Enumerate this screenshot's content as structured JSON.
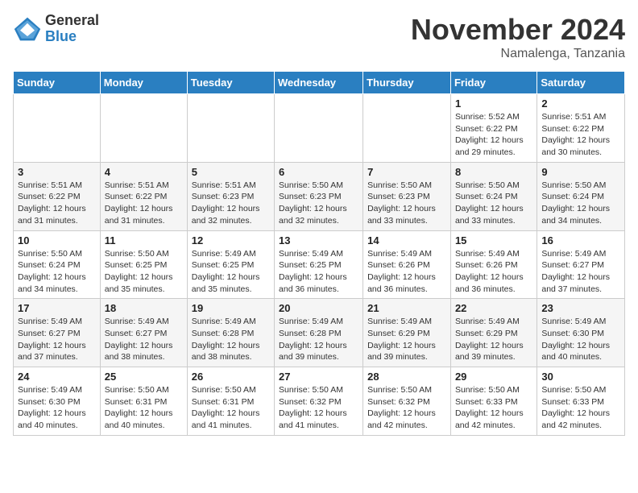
{
  "logo": {
    "general": "General",
    "blue": "Blue"
  },
  "title": "November 2024",
  "location": "Namalenga, Tanzania",
  "days_of_week": [
    "Sunday",
    "Monday",
    "Tuesday",
    "Wednesday",
    "Thursday",
    "Friday",
    "Saturday"
  ],
  "weeks": [
    [
      {
        "day": "",
        "detail": ""
      },
      {
        "day": "",
        "detail": ""
      },
      {
        "day": "",
        "detail": ""
      },
      {
        "day": "",
        "detail": ""
      },
      {
        "day": "",
        "detail": ""
      },
      {
        "day": "1",
        "detail": "Sunrise: 5:52 AM\nSunset: 6:22 PM\nDaylight: 12 hours and 29 minutes."
      },
      {
        "day": "2",
        "detail": "Sunrise: 5:51 AM\nSunset: 6:22 PM\nDaylight: 12 hours and 30 minutes."
      }
    ],
    [
      {
        "day": "3",
        "detail": "Sunrise: 5:51 AM\nSunset: 6:22 PM\nDaylight: 12 hours and 31 minutes."
      },
      {
        "day": "4",
        "detail": "Sunrise: 5:51 AM\nSunset: 6:22 PM\nDaylight: 12 hours and 31 minutes."
      },
      {
        "day": "5",
        "detail": "Sunrise: 5:51 AM\nSunset: 6:23 PM\nDaylight: 12 hours and 32 minutes."
      },
      {
        "day": "6",
        "detail": "Sunrise: 5:50 AM\nSunset: 6:23 PM\nDaylight: 12 hours and 32 minutes."
      },
      {
        "day": "7",
        "detail": "Sunrise: 5:50 AM\nSunset: 6:23 PM\nDaylight: 12 hours and 33 minutes."
      },
      {
        "day": "8",
        "detail": "Sunrise: 5:50 AM\nSunset: 6:24 PM\nDaylight: 12 hours and 33 minutes."
      },
      {
        "day": "9",
        "detail": "Sunrise: 5:50 AM\nSunset: 6:24 PM\nDaylight: 12 hours and 34 minutes."
      }
    ],
    [
      {
        "day": "10",
        "detail": "Sunrise: 5:50 AM\nSunset: 6:24 PM\nDaylight: 12 hours and 34 minutes."
      },
      {
        "day": "11",
        "detail": "Sunrise: 5:50 AM\nSunset: 6:25 PM\nDaylight: 12 hours and 35 minutes."
      },
      {
        "day": "12",
        "detail": "Sunrise: 5:49 AM\nSunset: 6:25 PM\nDaylight: 12 hours and 35 minutes."
      },
      {
        "day": "13",
        "detail": "Sunrise: 5:49 AM\nSunset: 6:25 PM\nDaylight: 12 hours and 36 minutes."
      },
      {
        "day": "14",
        "detail": "Sunrise: 5:49 AM\nSunset: 6:26 PM\nDaylight: 12 hours and 36 minutes."
      },
      {
        "day": "15",
        "detail": "Sunrise: 5:49 AM\nSunset: 6:26 PM\nDaylight: 12 hours and 36 minutes."
      },
      {
        "day": "16",
        "detail": "Sunrise: 5:49 AM\nSunset: 6:27 PM\nDaylight: 12 hours and 37 minutes."
      }
    ],
    [
      {
        "day": "17",
        "detail": "Sunrise: 5:49 AM\nSunset: 6:27 PM\nDaylight: 12 hours and 37 minutes."
      },
      {
        "day": "18",
        "detail": "Sunrise: 5:49 AM\nSunset: 6:27 PM\nDaylight: 12 hours and 38 minutes."
      },
      {
        "day": "19",
        "detail": "Sunrise: 5:49 AM\nSunset: 6:28 PM\nDaylight: 12 hours and 38 minutes."
      },
      {
        "day": "20",
        "detail": "Sunrise: 5:49 AM\nSunset: 6:28 PM\nDaylight: 12 hours and 39 minutes."
      },
      {
        "day": "21",
        "detail": "Sunrise: 5:49 AM\nSunset: 6:29 PM\nDaylight: 12 hours and 39 minutes."
      },
      {
        "day": "22",
        "detail": "Sunrise: 5:49 AM\nSunset: 6:29 PM\nDaylight: 12 hours and 39 minutes."
      },
      {
        "day": "23",
        "detail": "Sunrise: 5:49 AM\nSunset: 6:30 PM\nDaylight: 12 hours and 40 minutes."
      }
    ],
    [
      {
        "day": "24",
        "detail": "Sunrise: 5:49 AM\nSunset: 6:30 PM\nDaylight: 12 hours and 40 minutes."
      },
      {
        "day": "25",
        "detail": "Sunrise: 5:50 AM\nSunset: 6:31 PM\nDaylight: 12 hours and 40 minutes."
      },
      {
        "day": "26",
        "detail": "Sunrise: 5:50 AM\nSunset: 6:31 PM\nDaylight: 12 hours and 41 minutes."
      },
      {
        "day": "27",
        "detail": "Sunrise: 5:50 AM\nSunset: 6:32 PM\nDaylight: 12 hours and 41 minutes."
      },
      {
        "day": "28",
        "detail": "Sunrise: 5:50 AM\nSunset: 6:32 PM\nDaylight: 12 hours and 42 minutes."
      },
      {
        "day": "29",
        "detail": "Sunrise: 5:50 AM\nSunset: 6:33 PM\nDaylight: 12 hours and 42 minutes."
      },
      {
        "day": "30",
        "detail": "Sunrise: 5:50 AM\nSunset: 6:33 PM\nDaylight: 12 hours and 42 minutes."
      }
    ]
  ]
}
